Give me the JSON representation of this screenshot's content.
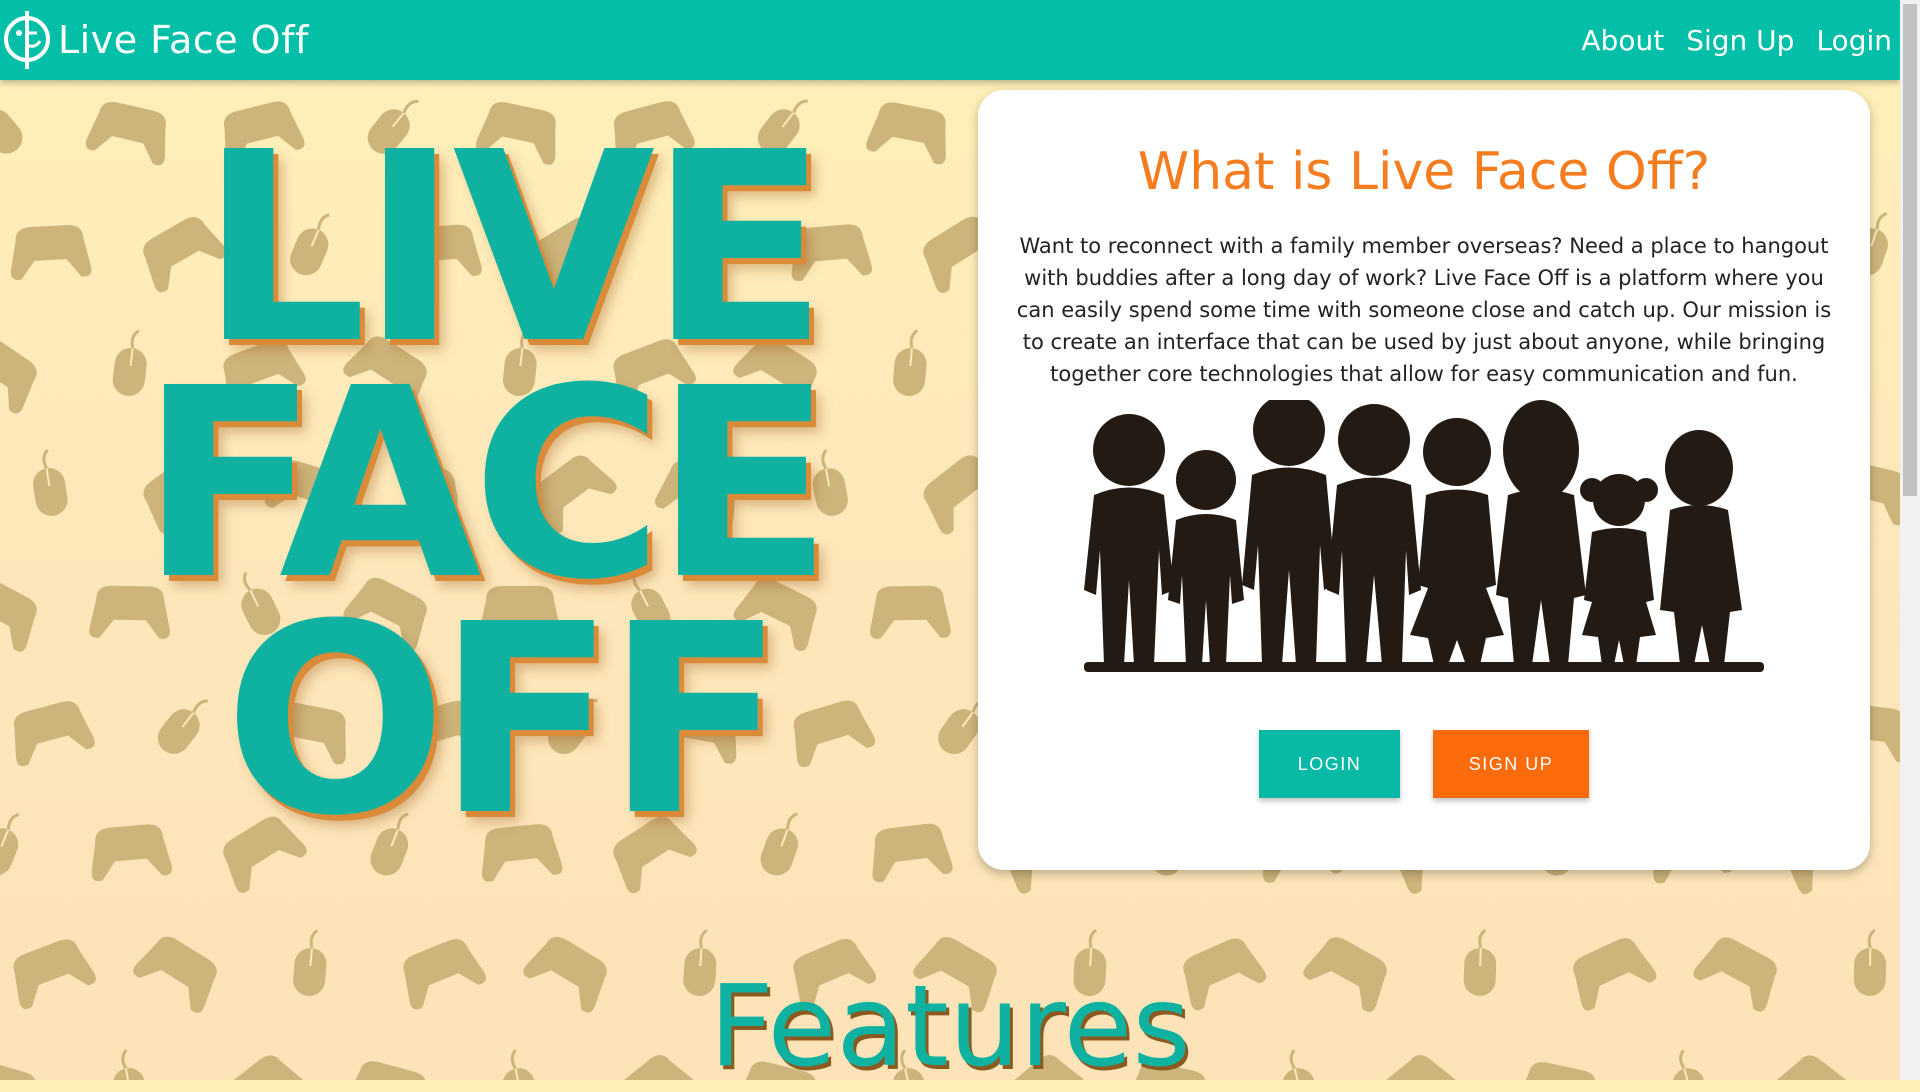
{
  "navbar": {
    "brand": "Live Face Off",
    "links": [
      "About",
      "Sign Up",
      "Login"
    ]
  },
  "hero": {
    "lines": [
      "LIVE",
      "FACE",
      "OFF"
    ]
  },
  "card": {
    "title": "What is Live Face Off?",
    "text": "Want to reconnect with a family member overseas? Need a place to hangout with buddies after a long day of work? Live Face Off is a platform where you can easily spend some time with someone close and catch up. Our mission is to create an interface that can be used by just about anyone, while bringing together core technologies that allow for easy communication and fun.",
    "login_label": "LOGIN",
    "signup_label": "SIGN UP"
  },
  "features": {
    "heading": "Features"
  },
  "icons": {
    "brand_logo": "face-logo-icon",
    "pattern": [
      "controller-icon",
      "mouse-icon"
    ]
  },
  "colors": {
    "primary": "#03bfa7",
    "accent": "#f57d1f",
    "signup": "#fb6b0c",
    "pattern": "#cdb47a"
  }
}
